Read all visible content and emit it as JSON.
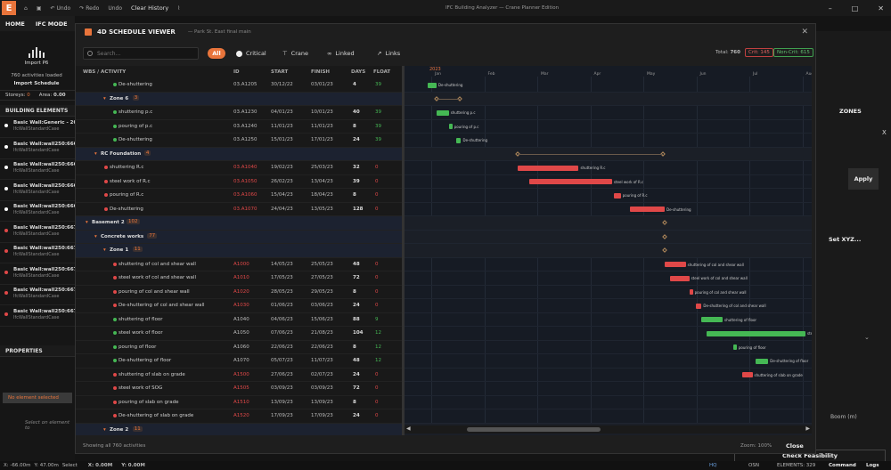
{
  "app": {
    "logo": "E",
    "title": "IFC Building Analyzer — Crane Planner Edition",
    "toolbar": [
      "Undo",
      "Redo",
      "Undo",
      "Clear History"
    ],
    "menu": [
      "HOME",
      "IFC MODE"
    ]
  },
  "left": {
    "import_label": "Import P6",
    "activities_loaded": "760 activities loaded",
    "import_schedule": "Import Schedule",
    "storeys_label": "Storeys:",
    "storeys_value": "0",
    "area_label": "Area:",
    "area_value": "0.00",
    "building_elements": "BUILDING ELEMENTS",
    "elements": [
      {
        "name": "Basic Wall:Generic - 200",
        "cls": "IfcWallStandardCase",
        "color": "#ffffff"
      },
      {
        "name": "Basic Wall:wall250:6660",
        "cls": "IfcWallStandardCase",
        "color": "#ffffff"
      },
      {
        "name": "Basic Wall:wall250:6660",
        "cls": "IfcWallStandardCase",
        "color": "#ffffff"
      },
      {
        "name": "Basic Wall:wall250:6660",
        "cls": "IfcWallStandardCase",
        "color": "#ffffff"
      },
      {
        "name": "Basic Wall:wall250:6660",
        "cls": "IfcWallStandardCase",
        "color": "#ffffff"
      },
      {
        "name": "Basic Wall:wall250:6672",
        "cls": "IfcWallStandardCase",
        "color": "#e04848"
      },
      {
        "name": "Basic Wall:wall250:6672",
        "cls": "IfcWallStandardCase",
        "color": "#e04848"
      },
      {
        "name": "Basic Wall:wall250:6672",
        "cls": "IfcWallStandardCase",
        "color": "#e04848"
      },
      {
        "name": "Basic Wall:wall250:6672",
        "cls": "IfcWallStandardCase",
        "color": "#e04848"
      },
      {
        "name": "Basic Wall:wall250:6672",
        "cls": "IfcWallStandardCase",
        "color": "#e04848"
      }
    ],
    "properties": "PROPERTIES",
    "no_element": "No element selected",
    "select_on": "Select on element to"
  },
  "status": {
    "x": "X: -66.00m",
    "y": "Y: 47.00m",
    "select": "Select",
    "x2": "X: 0.00M",
    "y2": "Y: 0.00M",
    "hq": "HQ",
    "osn": "OSN",
    "elements": "ELEMENTS: 329",
    "command": "Command",
    "logs": "Logs"
  },
  "right": {
    "zones": "ZONES",
    "x": "X",
    "apply": "Apply",
    "setxyz": "Set XYZ...",
    "boom": "Boom (m)",
    "check": "Check Feasibility"
  },
  "modal": {
    "title": "4D SCHEDULE VIEWER",
    "path": "— Park St. East final main",
    "search_placeholder": "Search...",
    "filters": {
      "all": "All",
      "critical": "Critical",
      "crane": "Crane",
      "linked": "Linked",
      "links": "Links"
    },
    "total_label": "Total:",
    "total": "760",
    "crit": "Crit: 145",
    "noncrit": "Non-Crit: 615",
    "columns": {
      "wbs": "WBS / ACTIVITY",
      "id": "ID",
      "start": "START",
      "finish": "FINISH",
      "days": "DAYS",
      "float": "FLOAT"
    },
    "year": "2023",
    "months": [
      "Jan",
      "Feb",
      "Mar",
      "Apr",
      "May",
      "Jun",
      "Jul",
      "Aug",
      "Sep"
    ],
    "footer": "Showing all 760 activities",
    "zoom": "Zoom: 100%",
    "close": "Close",
    "rows": [
      {
        "kind": "act",
        "lvl": 3,
        "name": "De-shuttering",
        "id": "03.A1205",
        "start": "30/12/22",
        "finish": "03/01/23",
        "days": "4",
        "float": "39",
        "dot": "#45b854",
        "idcolor": "#bbbbbb"
      },
      {
        "kind": "grp",
        "lvl": 2,
        "name": "Zone 6",
        "count": "3"
      },
      {
        "kind": "act",
        "lvl": 3,
        "name": "shuttering p.c",
        "id": "03.A1230",
        "start": "04/01/23",
        "finish": "10/01/23",
        "days": "40",
        "float": "39",
        "dot": "#45b854",
        "idcolor": "#bbbbbb"
      },
      {
        "kind": "act",
        "lvl": 3,
        "name": "pouring of p.c",
        "id": "03.A1240",
        "start": "11/01/23",
        "finish": "11/01/23",
        "days": "8",
        "float": "39",
        "dot": "#45b854",
        "idcolor": "#bbbbbb"
      },
      {
        "kind": "act",
        "lvl": 3,
        "name": "De-shuttering",
        "id": "03.A1250",
        "start": "15/01/23",
        "finish": "17/01/23",
        "days": "24",
        "float": "39",
        "dot": "#45b854",
        "idcolor": "#bbbbbb"
      },
      {
        "kind": "grp",
        "lvl": 1,
        "name": "RC Foundation",
        "count": "4"
      },
      {
        "kind": "act",
        "lvl": 2,
        "name": "shuttering R.c",
        "id": "03.A1040",
        "start": "19/02/23",
        "finish": "25/03/23",
        "days": "32",
        "float": "0",
        "dot": "#e04848",
        "idcolor": "#e04848"
      },
      {
        "kind": "act",
        "lvl": 2,
        "name": "steel work of R.c",
        "id": "03.A1050",
        "start": "26/02/23",
        "finish": "13/04/23",
        "days": "39",
        "float": "0",
        "dot": "#e04848",
        "idcolor": "#e04848"
      },
      {
        "kind": "act",
        "lvl": 2,
        "name": "pouring of R.c",
        "id": "03.A1060",
        "start": "15/04/23",
        "finish": "18/04/23",
        "days": "8",
        "float": "0",
        "dot": "#e04848",
        "idcolor": "#e04848"
      },
      {
        "kind": "act",
        "lvl": 2,
        "name": "De-shuttering",
        "id": "03.A1070",
        "start": "24/04/23",
        "finish": "13/05/23",
        "days": "128",
        "float": "0",
        "dot": "#e04848",
        "idcolor": "#e04848"
      },
      {
        "kind": "grp",
        "lvl": 0,
        "name": "Basement 2",
        "count": "102"
      },
      {
        "kind": "grp",
        "lvl": 1,
        "name": "Concrete works",
        "count": "77"
      },
      {
        "kind": "grp",
        "lvl": 2,
        "name": "Zone 1",
        "count": "11"
      },
      {
        "kind": "act",
        "lvl": 3,
        "name": "shuttering of col and shear wall",
        "id": "A1000",
        "start": "14/05/23",
        "finish": "25/05/23",
        "days": "48",
        "float": "0",
        "dot": "#e04848",
        "idcolor": "#e04848"
      },
      {
        "kind": "act",
        "lvl": 3,
        "name": "steel work of col and shear wall",
        "id": "A1010",
        "start": "17/05/23",
        "finish": "27/05/23",
        "days": "72",
        "float": "0",
        "dot": "#e04848",
        "idcolor": "#e04848"
      },
      {
        "kind": "act",
        "lvl": 3,
        "name": "pouring of col and shear wall",
        "id": "A1020",
        "start": "28/05/23",
        "finish": "29/05/23",
        "days": "8",
        "float": "0",
        "dot": "#e04848",
        "idcolor": "#e04848"
      },
      {
        "kind": "act",
        "lvl": 3,
        "name": "De-shuttering of col and shear wall",
        "id": "A1030",
        "start": "01/06/23",
        "finish": "03/06/23",
        "days": "24",
        "float": "0",
        "dot": "#e04848",
        "idcolor": "#e04848"
      },
      {
        "kind": "act",
        "lvl": 3,
        "name": "shuttering of floor",
        "id": "A1040",
        "start": "04/06/23",
        "finish": "15/06/23",
        "days": "88",
        "float": "9",
        "dot": "#45b854",
        "idcolor": "#bbbbbb"
      },
      {
        "kind": "act",
        "lvl": 3,
        "name": "steel work of floor",
        "id": "A1050",
        "start": "07/06/23",
        "finish": "21/08/23",
        "days": "104",
        "float": "12",
        "dot": "#45b854",
        "idcolor": "#bbbbbb"
      },
      {
        "kind": "act",
        "lvl": 3,
        "name": "pouring of floor",
        "id": "A1060",
        "start": "22/06/23",
        "finish": "22/06/23",
        "days": "8",
        "float": "12",
        "dot": "#45b854",
        "idcolor": "#bbbbbb"
      },
      {
        "kind": "act",
        "lvl": 3,
        "name": "De-shuttering of floor",
        "id": "A1070",
        "start": "05/07/23",
        "finish": "11/07/23",
        "days": "48",
        "float": "12",
        "dot": "#45b854",
        "idcolor": "#bbbbbb"
      },
      {
        "kind": "act",
        "lvl": 3,
        "name": "shuttering of slab on grade",
        "id": "A1500",
        "start": "27/06/23",
        "finish": "02/07/23",
        "days": "24",
        "float": "0",
        "dot": "#e04848",
        "idcolor": "#e04848"
      },
      {
        "kind": "act",
        "lvl": 3,
        "name": "steel work of SOG",
        "id": "A1505",
        "start": "03/09/23",
        "finish": "03/09/23",
        "days": "72",
        "float": "0",
        "dot": "#e04848",
        "idcolor": "#e04848"
      },
      {
        "kind": "act",
        "lvl": 3,
        "name": "pouring of slab on grade",
        "id": "A1510",
        "start": "13/09/23",
        "finish": "13/09/23",
        "days": "8",
        "float": "0",
        "dot": "#e04848",
        "idcolor": "#e04848"
      },
      {
        "kind": "act",
        "lvl": 3,
        "name": "De-shuttering of slab on grade",
        "id": "A1520",
        "start": "17/09/23",
        "finish": "17/09/23",
        "days": "24",
        "float": "0",
        "dot": "#e04848",
        "idcolor": "#e04848"
      },
      {
        "kind": "grp",
        "lvl": 2,
        "name": "Zone 2",
        "count": "11"
      }
    ]
  }
}
